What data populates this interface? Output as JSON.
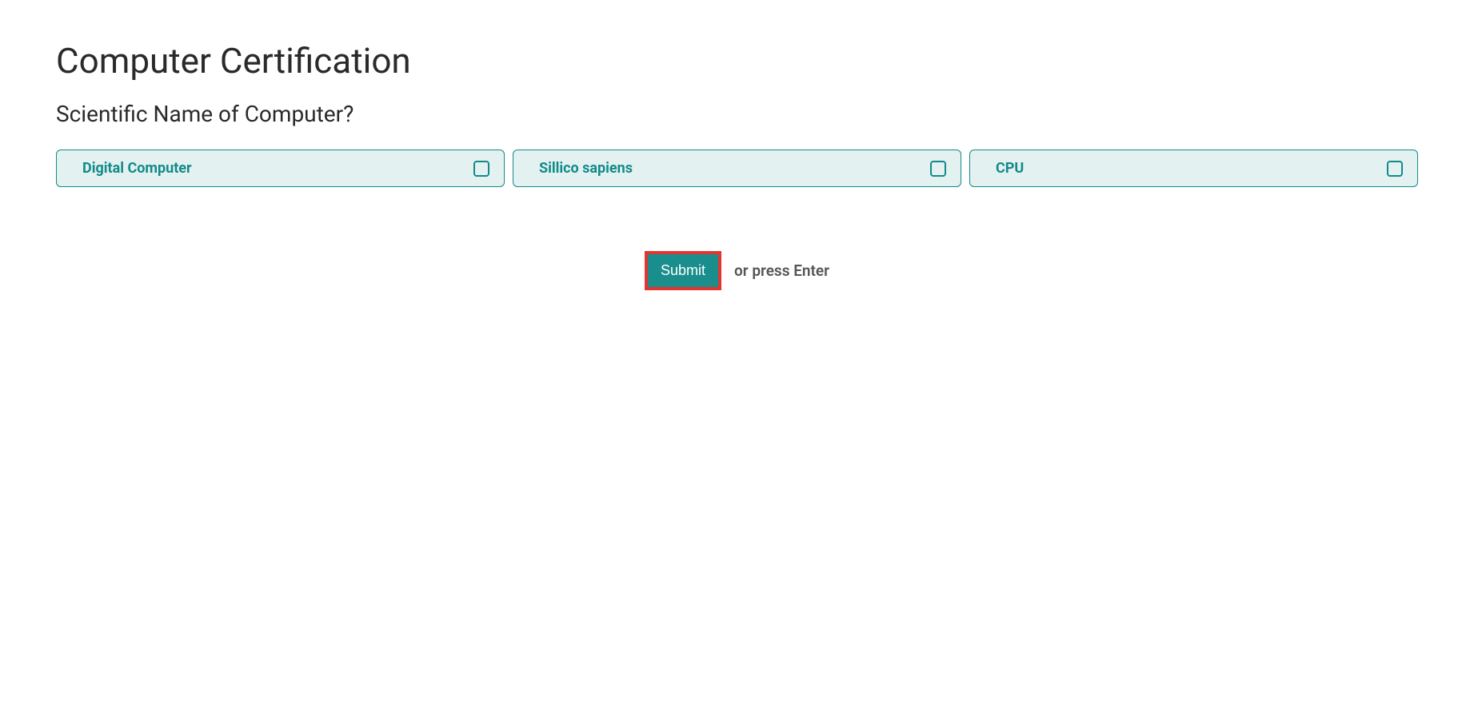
{
  "title": "Computer Certification",
  "question": "Scientific Name of Computer?",
  "options": [
    {
      "label": "Digital Computer"
    },
    {
      "label": "Sillico sapiens"
    },
    {
      "label": "CPU"
    }
  ],
  "submit": {
    "button_label": "Submit",
    "hint": "or press Enter"
  }
}
